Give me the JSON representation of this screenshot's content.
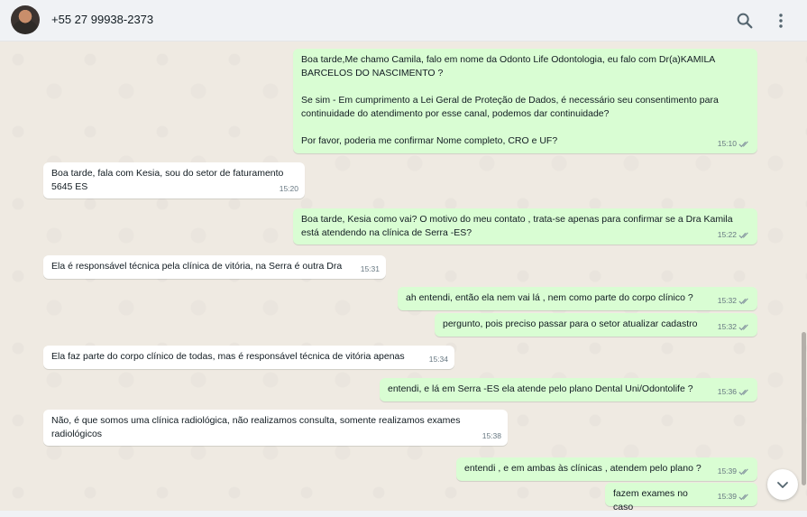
{
  "header": {
    "contact_name": "+55 27 99938-2373",
    "avatar_icon": "profile-photo",
    "search_icon": "search-icon",
    "menu_icon": "more-vertical-icon"
  },
  "colors": {
    "incoming_bubble": "#ffffff",
    "outgoing_bubble": "#d9fdd3",
    "chat_background": "#efeae2",
    "header_background": "#f0f2f5",
    "tick_color": "#8696a0"
  },
  "messages": [
    {
      "direction": "out",
      "text": "Boa tarde,Me chamo Camila, falo em nome da Odonto Life Odontologia, eu falo com Dr(a)KAMILA BARCELOS DO NASCIMENTO ?\n\nSe sim - Em cumprimento a Lei Geral de Proteção de Dados, é necessário seu consentimento para continuidade do atendimento por esse canal, podemos dar continuidade?\n\nPor favor, poderia me confirmar Nome completo, CRO e UF?",
      "time": "15:10",
      "status": "read"
    },
    {
      "direction": "in",
      "text": "Boa tarde, fala com Kesia, sou do setor de faturamento 5645 ES",
      "time": "15:20"
    },
    {
      "direction": "out",
      "text": "Boa tarde, Kesia como vai? O motivo do meu contato , trata-se apenas para confirmar se a Dra Kamila está atendendo na clínica de Serra -ES?",
      "time": "15:22",
      "status": "read"
    },
    {
      "direction": "in",
      "text": "Ela é responsável técnica pela clínica de vitória, na Serra é outra Dra",
      "time": "15:31"
    },
    {
      "direction": "out",
      "text": "ah entendi, então ela nem vai lá , nem como parte do corpo clínico ?",
      "time": "15:32",
      "status": "read"
    },
    {
      "direction": "out",
      "text": "pergunto, pois preciso passar para o setor atualizar cadastro",
      "time": "15:32",
      "status": "read"
    },
    {
      "direction": "in",
      "text": "Ela faz parte do corpo clínico de todas, mas é responsável técnica de vitória apenas",
      "time": "15:34"
    },
    {
      "direction": "out",
      "text": "entendi, e lá em Serra -ES ela atende pelo plano Dental Uni/Odontolife ?",
      "time": "15:36",
      "status": "read"
    },
    {
      "direction": "in",
      "text": "Não, é que somos uma clínica radiológica, não realizamos consulta, somente realizamos exames radiológicos",
      "time": "15:38"
    },
    {
      "direction": "out",
      "text": "entendi , e em ambas às clínicas , atendem pelo plano ?",
      "time": "15:39",
      "status": "read"
    },
    {
      "direction": "out",
      "text": "fazem exames no caso",
      "time": "15:39",
      "status": "read"
    }
  ],
  "scroll_down_icon": "chevron-down-icon"
}
